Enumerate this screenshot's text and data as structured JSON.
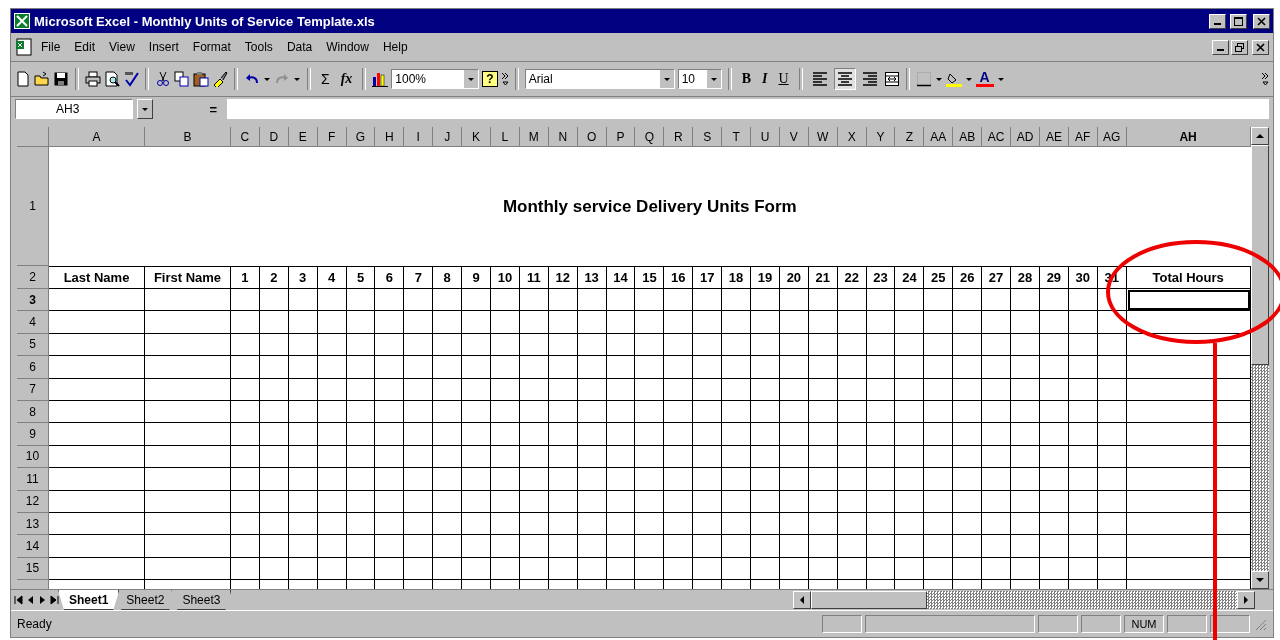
{
  "window": {
    "title": "Microsoft Excel - Monthly Units of Service Template.xls"
  },
  "menu": [
    "File",
    "Edit",
    "View",
    "Insert",
    "Format",
    "Tools",
    "Data",
    "Window",
    "Help"
  ],
  "toolbar": {
    "autosum": "Σ",
    "function": "fx",
    "zoom": "100%",
    "help": "?",
    "font": "Arial",
    "font_size": "10",
    "bold": "B",
    "italic": "I",
    "underline": "U",
    "font_color": "A",
    "redo_disabled": true,
    "align_buttons": [
      {
        "selected": false
      },
      {
        "selected": true
      },
      {
        "selected": false
      }
    ]
  },
  "formula_bar": {
    "name_box": "AH3",
    "equals": "="
  },
  "grid": {
    "columns": [
      {
        "label": "A",
        "selected": false
      },
      {
        "label": "B",
        "selected": false
      },
      {
        "label": "C",
        "selected": false
      },
      {
        "label": "D",
        "selected": false
      },
      {
        "label": "E",
        "selected": false
      },
      {
        "label": "F",
        "selected": false
      },
      {
        "label": "G",
        "selected": false
      },
      {
        "label": "H",
        "selected": false
      },
      {
        "label": "I",
        "selected": false
      },
      {
        "label": "J",
        "selected": false
      },
      {
        "label": "K",
        "selected": false
      },
      {
        "label": "L",
        "selected": false
      },
      {
        "label": "M",
        "selected": false
      },
      {
        "label": "N",
        "selected": false
      },
      {
        "label": "O",
        "selected": false
      },
      {
        "label": "P",
        "selected": false
      },
      {
        "label": "Q",
        "selected": false
      },
      {
        "label": "R",
        "selected": false
      },
      {
        "label": "S",
        "selected": false
      },
      {
        "label": "T",
        "selected": false
      },
      {
        "label": "U",
        "selected": false
      },
      {
        "label": "V",
        "selected": false
      },
      {
        "label": "W",
        "selected": false
      },
      {
        "label": "X",
        "selected": false
      },
      {
        "label": "Y",
        "selected": false
      },
      {
        "label": "Z",
        "selected": false
      },
      {
        "label": "AA",
        "selected": false
      },
      {
        "label": "AB",
        "selected": false
      },
      {
        "label": "AC",
        "selected": false
      },
      {
        "label": "AD",
        "selected": false
      },
      {
        "label": "AE",
        "selected": false
      },
      {
        "label": "AF",
        "selected": false
      },
      {
        "label": "AG",
        "selected": false
      },
      {
        "label": "AH",
        "selected": true
      }
    ],
    "rows": [
      {
        "label": "1",
        "selected": false
      },
      {
        "label": "2",
        "selected": false
      },
      {
        "label": "3",
        "selected": true
      },
      {
        "label": "4",
        "selected": false
      },
      {
        "label": "5",
        "selected": false
      },
      {
        "label": "6",
        "selected": false
      },
      {
        "label": "7",
        "selected": false
      },
      {
        "label": "8",
        "selected": false
      },
      {
        "label": "9",
        "selected": false
      },
      {
        "label": "10",
        "selected": false
      },
      {
        "label": "11",
        "selected": false
      },
      {
        "label": "12",
        "selected": false
      },
      {
        "label": "13",
        "selected": false
      },
      {
        "label": "14",
        "selected": false
      },
      {
        "label": "15",
        "selected": false
      }
    ],
    "title": "Monthly service Delivery Units Form",
    "header_cells": [
      "Last Name",
      "First Name",
      "1",
      "2",
      "3",
      "4",
      "5",
      "6",
      "7",
      "8",
      "9",
      "10",
      "11",
      "12",
      "13",
      "14",
      "15",
      "16",
      "17",
      "18",
      "19",
      "20",
      "21",
      "22",
      "23",
      "24",
      "25",
      "26",
      "27",
      "28",
      "29",
      "30",
      "31",
      "Total Hours"
    ]
  },
  "sheet_tabs": [
    {
      "label": "Sheet1",
      "selected": true
    },
    {
      "label": "Sheet2",
      "selected": false
    },
    {
      "label": "Sheet3",
      "selected": false
    }
  ],
  "status_bar": {
    "status": "Ready",
    "num_indicator": "NUM"
  }
}
